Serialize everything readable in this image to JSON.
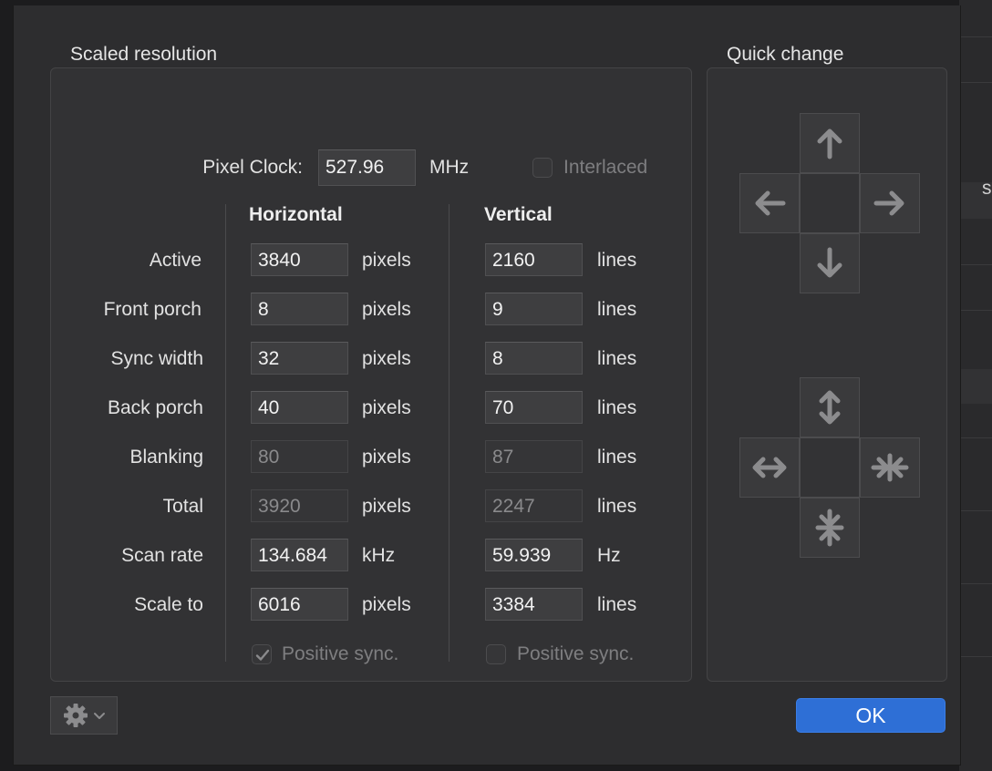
{
  "scaled": {
    "title": "Scaled resolution",
    "pixel_clock_label": "Pixel Clock:",
    "pixel_clock_value": "527.96",
    "pixel_clock_unit": "MHz",
    "interlaced_label": "Interlaced",
    "horizontal_header": "Horizontal",
    "vertical_header": "Vertical",
    "rows": [
      {
        "label": "Active",
        "h": "3840",
        "h_unit": "pixels",
        "v": "2160",
        "v_unit": "lines"
      },
      {
        "label": "Front porch",
        "h": "8",
        "h_unit": "pixels",
        "v": "9",
        "v_unit": "lines"
      },
      {
        "label": "Sync width",
        "h": "32",
        "h_unit": "pixels",
        "v": "8",
        "v_unit": "lines"
      },
      {
        "label": "Back porch",
        "h": "40",
        "h_unit": "pixels",
        "v": "70",
        "v_unit": "lines"
      },
      {
        "label": "Blanking",
        "h": "80",
        "h_unit": "pixels",
        "v": "87",
        "v_unit": "lines"
      },
      {
        "label": "Total",
        "h": "3920",
        "h_unit": "pixels",
        "v": "2247",
        "v_unit": "lines"
      },
      {
        "label": "Scan rate",
        "h": "134.684",
        "h_unit": "kHz",
        "v": "59.939",
        "v_unit": "Hz"
      },
      {
        "label": "Scale to",
        "h": "6016",
        "h_unit": "pixels",
        "v": "3384",
        "v_unit": "lines"
      }
    ],
    "h_positive_sync_label": "Positive sync.",
    "v_positive_sync_label": "Positive sync."
  },
  "quick": {
    "title": "Quick change"
  },
  "footer": {
    "ok_label": "OK"
  },
  "background": {
    "edge_letter": "s"
  },
  "colors": {
    "accent": "#2e6fd6"
  }
}
